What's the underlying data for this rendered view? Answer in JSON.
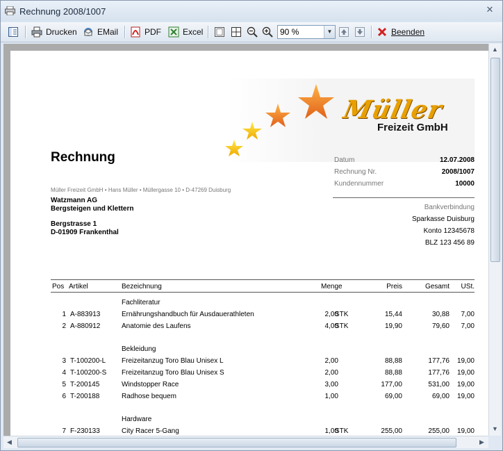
{
  "window": {
    "title": "Rechnung 2008/1007"
  },
  "toolbar": {
    "print_label": "Drucken",
    "email_label": "EMail",
    "pdf_label": "PDF",
    "excel_label": "Excel",
    "zoom_value": "90 %",
    "exit_label": "Beenden"
  },
  "invoice": {
    "heading": "Rechnung",
    "brand": "Müller",
    "brand_sub": "Freizeit GmbH",
    "sender_line": "Müller Freizeit GmbH • Hans Müller • Müllergasse 10 • D-47269 Duisburg",
    "recipient": [
      "Watzmann AG",
      "Bergsteigen und Klettern",
      "Bergstrasse 1",
      "D-01909 Frankenthal"
    ],
    "meta": [
      {
        "label": "Datum",
        "value": "12.07.2008"
      },
      {
        "label": "Rechnung Nr.",
        "value": "2008/1007"
      },
      {
        "label": "Kundennummer",
        "value": "10000"
      }
    ],
    "bank": [
      "Bankverbindung",
      "Sparkasse Duisburg",
      "Konto 12345678",
      "BLZ 123 456 89"
    ],
    "columns": [
      "Pos",
      "Artikel",
      "Bezeichnung",
      "Menge",
      "Preis",
      "Gesamt",
      "USt."
    ],
    "groups": [
      {
        "name": "Fachliteratur",
        "rows": [
          {
            "pos": "1",
            "article": "A-883913",
            "desc": "Ernährungshandbuch für Ausdauerathleten",
            "qty": "2,00",
            "unit": "STK",
            "price": "15,44",
            "total": "30,88",
            "vat": "7,00"
          },
          {
            "pos": "2",
            "article": "A-880912",
            "desc": "Anatomie des Laufens",
            "qty": "4,00",
            "unit": "STK",
            "price": "19,90",
            "total": "79,60",
            "vat": "7,00"
          }
        ]
      },
      {
        "name": "Bekleidung",
        "rows": [
          {
            "pos": "3",
            "article": "T-100200-L",
            "desc": "Freizeitanzug Toro Blau Unisex L",
            "qty": "2,00",
            "unit": "",
            "price": "88,88",
            "total": "177,76",
            "vat": "19,00"
          },
          {
            "pos": "4",
            "article": "T-100200-S",
            "desc": "Freizeitanzug Toro Blau Unisex S",
            "qty": "2,00",
            "unit": "",
            "price": "88,88",
            "total": "177,76",
            "vat": "19,00"
          },
          {
            "pos": "5",
            "article": "T-200145",
            "desc": "Windstopper Race",
            "qty": "3,00",
            "unit": "",
            "price": "177,00",
            "total": "531,00",
            "vat": "19,00"
          },
          {
            "pos": "6",
            "article": "T-200188",
            "desc": "Radhose bequem",
            "qty": "1,00",
            "unit": "",
            "price": "69,00",
            "total": "69,00",
            "vat": "19,00"
          }
        ]
      },
      {
        "name": "Hardware",
        "rows": [
          {
            "pos": "7",
            "article": "F-230133",
            "desc": "City Racer 5-Gang",
            "qty": "1,00",
            "unit": "STK",
            "price": "255,00",
            "total": "255,00",
            "vat": "19,00"
          }
        ]
      }
    ]
  },
  "colors": {
    "accent_red": "#d21f1f",
    "star_orange": "#f08a1c",
    "star_yellow": "#f5c400"
  }
}
